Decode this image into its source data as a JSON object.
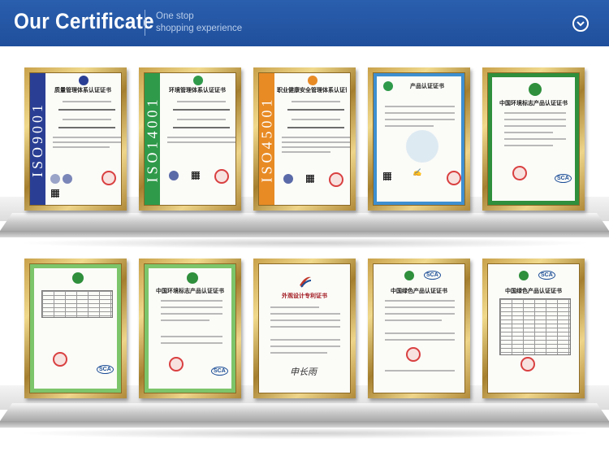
{
  "header": {
    "title": "Our Certificate",
    "subtitle_line1": "One stop",
    "subtitle_line2": "shopping experience",
    "scroll_icon": "chevron-down-circle-icon"
  },
  "certificates_row1": [
    {
      "title": "质量管理体系认证证书",
      "band_text": "ISO9001",
      "band_color": "#2a3f94"
    },
    {
      "title": "环境管理体系认证证书",
      "band_text": "ISO14001",
      "band_color": "#2f9a4a"
    },
    {
      "title": "职业健康安全管理体系认证证书",
      "band_text": "ISO45001",
      "band_color": "#e88b25"
    },
    {
      "title": "产品认证证书",
      "band_color": "#3d8fd0"
    },
    {
      "title": "中国环境标志产品认证证书",
      "band_color": "#2f8f3c"
    }
  ],
  "certificates_row2": [
    {
      "title": "",
      "band_color": "#7dc56a"
    },
    {
      "title": "中国环境标志产品认证证书",
      "band_color": "#7dc56a"
    },
    {
      "title": "外观设计专利证书",
      "band_color": "#ffffff"
    },
    {
      "title": "中国绿色产品认证证书",
      "band_color": "#ffffff"
    },
    {
      "title": "中国绿色产品认证证书",
      "band_color": "#ffffff"
    }
  ],
  "stamp_text": "SCA",
  "signature_text": "申长雨"
}
